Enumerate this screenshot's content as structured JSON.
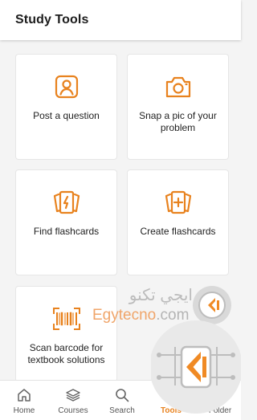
{
  "header": {
    "title": "Study Tools"
  },
  "tools": [
    {
      "label": "Post a question",
      "icon": "person-card-icon"
    },
    {
      "label": "Snap a pic of your problem",
      "icon": "camera-icon"
    },
    {
      "label": "Find flashcards",
      "icon": "flashcards-icon"
    },
    {
      "label": "Create flashcards",
      "icon": "add-flashcards-icon"
    },
    {
      "label": "Scan barcode for textbook solutions",
      "icon": "barcode-icon"
    }
  ],
  "watermark": {
    "arabic": "ايجي تكنو",
    "latin_a": "Egytecno",
    "latin_b": ".com"
  },
  "tabs": [
    {
      "label": "Home",
      "icon": "home-icon",
      "active": false
    },
    {
      "label": "Courses",
      "icon": "stack-icon",
      "active": false
    },
    {
      "label": "Search",
      "icon": "search-icon",
      "active": false
    },
    {
      "label": "Tools",
      "icon": "tools-icon",
      "active": true
    },
    {
      "label": "Folder",
      "icon": "folder-icon",
      "active": false
    }
  ],
  "colors": {
    "accent": "#e8821e",
    "background": "#f4f4f4",
    "card": "#ffffff"
  }
}
